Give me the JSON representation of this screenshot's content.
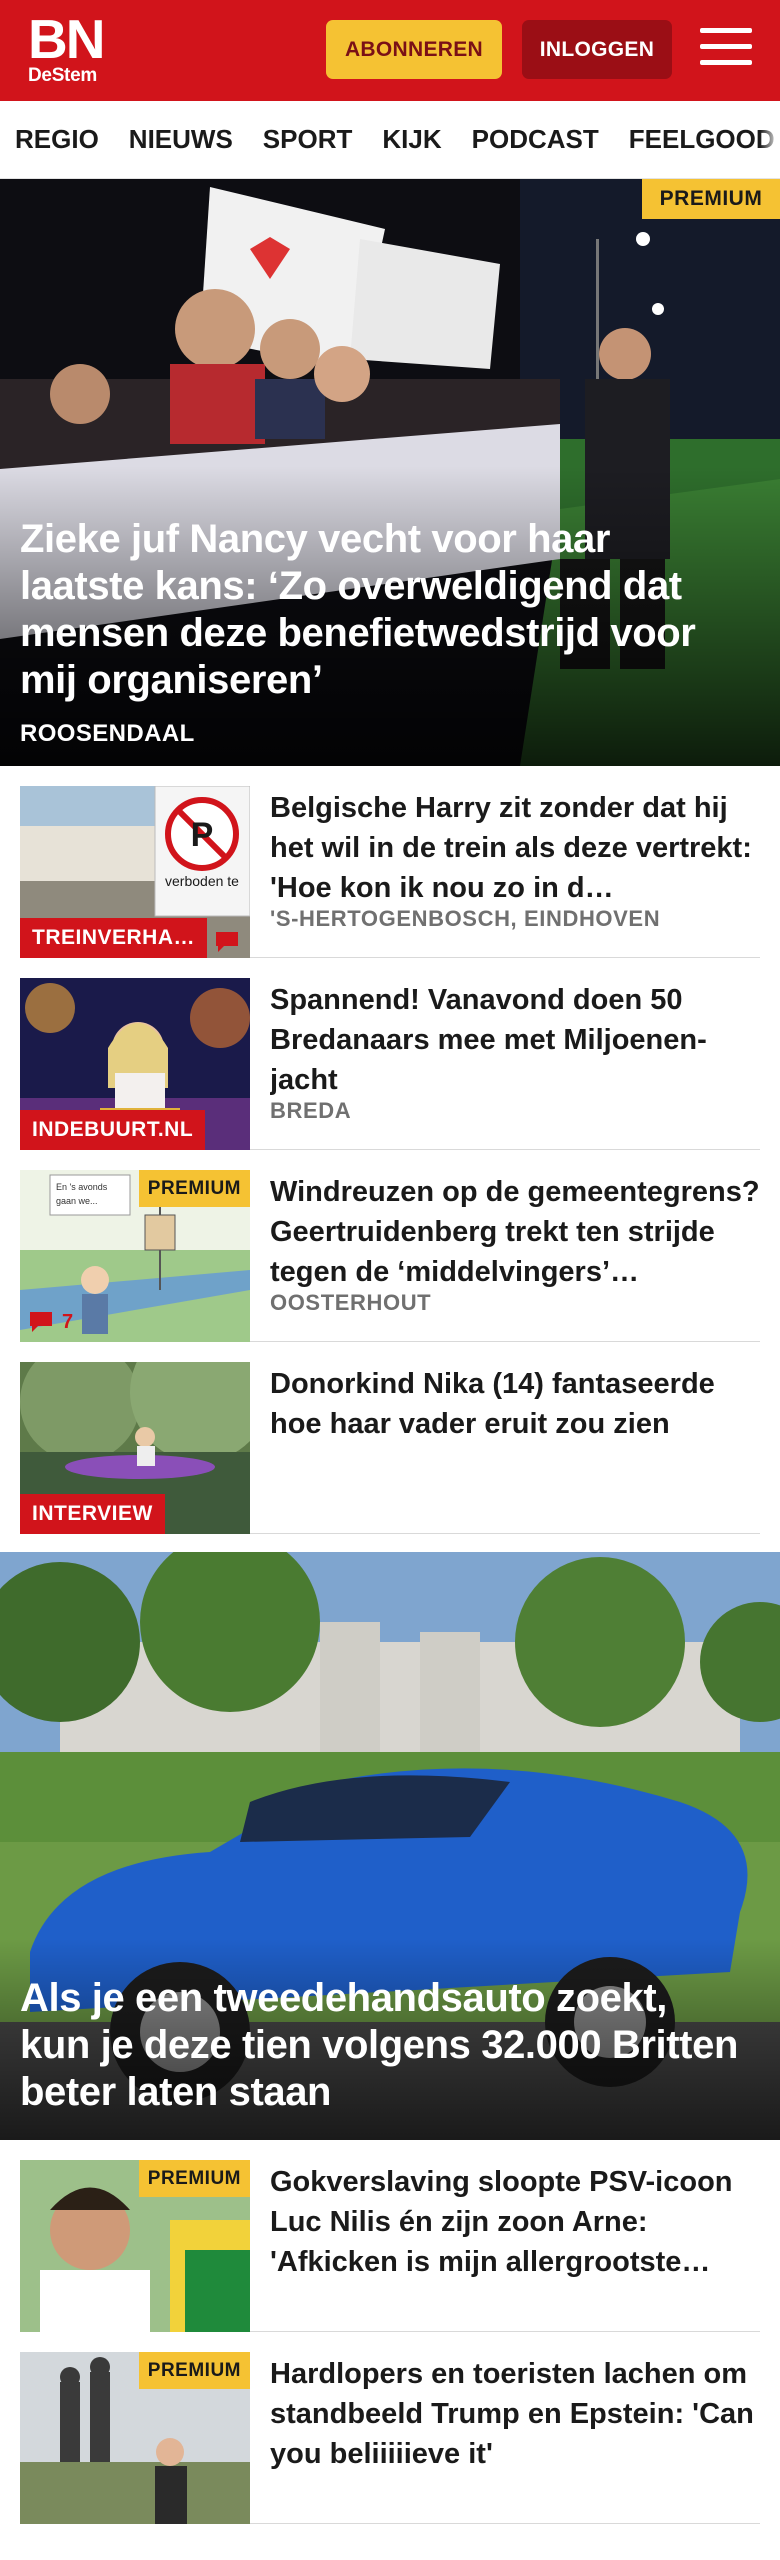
{
  "header": {
    "logo_main": "BN",
    "logo_sub": "DeStem",
    "subscribe_label": "ABONNEREN",
    "login_label": "INLOGGEN",
    "brand_color": "#d1141b",
    "accent_color": "#f5c233"
  },
  "nav": {
    "items": [
      "REGIO",
      "NIEUWS",
      "SPORT",
      "KIJK",
      "PODCAST",
      "FEELGOOD"
    ]
  },
  "hero": {
    "badge": "PREMIUM",
    "title": "Zieke juf Nancy vecht voor haar laatste kans: ‘Zo overweldigend dat mensen deze benefietwedstrijd voor mij organiseren’",
    "location": "ROOSENDAAL"
  },
  "articles": [
    {
      "title": "Belgische Harry zit zonder dat hij het wil in de trein als deze vertrekt: 'Hoe kon ik nou zo in d…",
      "location": "'S-HERTOGENBOSCH, EINDHOVEN",
      "tag": "TREINVERHA…",
      "sign_text": "verboden te",
      "icon": "comment-icon"
    },
    {
      "title": "Spannend! Vanavond doen 50 Bredanaars mee met Miljoenen­jacht",
      "location": "BREDA",
      "tag": "INDEBUURT.NL"
    },
    {
      "title": "Windreuzen op de gemeente­grens? Geertruidenberg trekt ten strijde tegen de ‘middelvingers’…",
      "location": "OOSTERHOUT",
      "badge": "PREMIUM",
      "comments": "7",
      "cartoon_text": "En 's avonds gaan we de lucht in zitten"
    },
    {
      "title": "Donorkind Nika (14) fantaseerde hoe haar vader eruit zou zien",
      "tag": "INTERVIEW"
    }
  ],
  "feature": {
    "title": "Als je een tweedehandsauto zoekt, kun je deze tien volgens 32.000 Britten beter laten staan"
  },
  "articles2": [
    {
      "title": "Gokverslaving sloopte PSV-icoon Luc Nilis én zijn zoon Arne: 'Afkicken is mijn allergrootste…",
      "badge": "PREMIUM"
    },
    {
      "title": "Hardlopers en toeristen lachen om standbeeld Trump en Epstein: 'Can you beliiiiieve it'",
      "badge": "PREMIUM"
    }
  ]
}
